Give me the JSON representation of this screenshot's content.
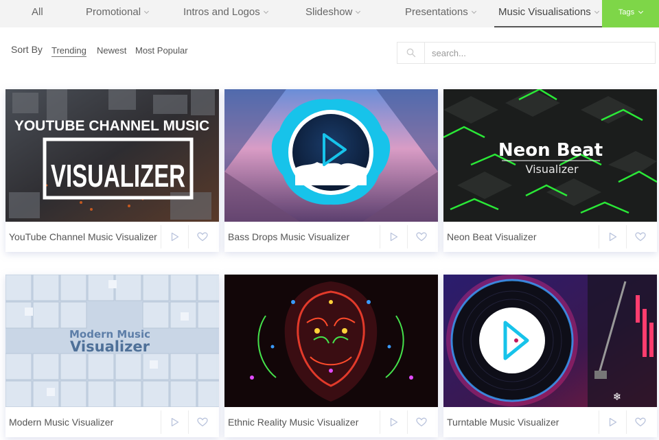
{
  "nav": {
    "items": [
      {
        "label": "All"
      },
      {
        "label": "Promotional"
      },
      {
        "label": "Intros and Logos"
      },
      {
        "label": "Slideshow"
      },
      {
        "label": "Presentations"
      },
      {
        "label": "Music Visualisations"
      }
    ],
    "tags_label": "Tags"
  },
  "sort": {
    "label": "Sort By",
    "options": [
      "Trending",
      "Newest",
      "Most Popular"
    ],
    "active": "Trending"
  },
  "search": {
    "placeholder": "search..."
  },
  "cards": [
    {
      "title": "YouTube Channel Music Visualizer",
      "thumb_text": [
        "YOUTUBE CHANNEL MUSIC",
        "VISUALIZER"
      ]
    },
    {
      "title": "Bass Drops Music Visualizer"
    },
    {
      "title": "Neon Beat Visualizer",
      "thumb_text": [
        "Neon Beat",
        "Visualizer"
      ]
    },
    {
      "title": "Modern Music Visualizer",
      "thumb_text": [
        "Modern Music",
        "Visualizer"
      ]
    },
    {
      "title": "Ethnic Reality Music Visualizer"
    },
    {
      "title": "Turntable Music Visualizer"
    }
  ],
  "colors": {
    "accent": "#7ed648",
    "nav_bg": "#f3f3f3"
  },
  "icons": {
    "play": "play-icon",
    "favorite": "heart-icon",
    "search": "search-icon"
  }
}
